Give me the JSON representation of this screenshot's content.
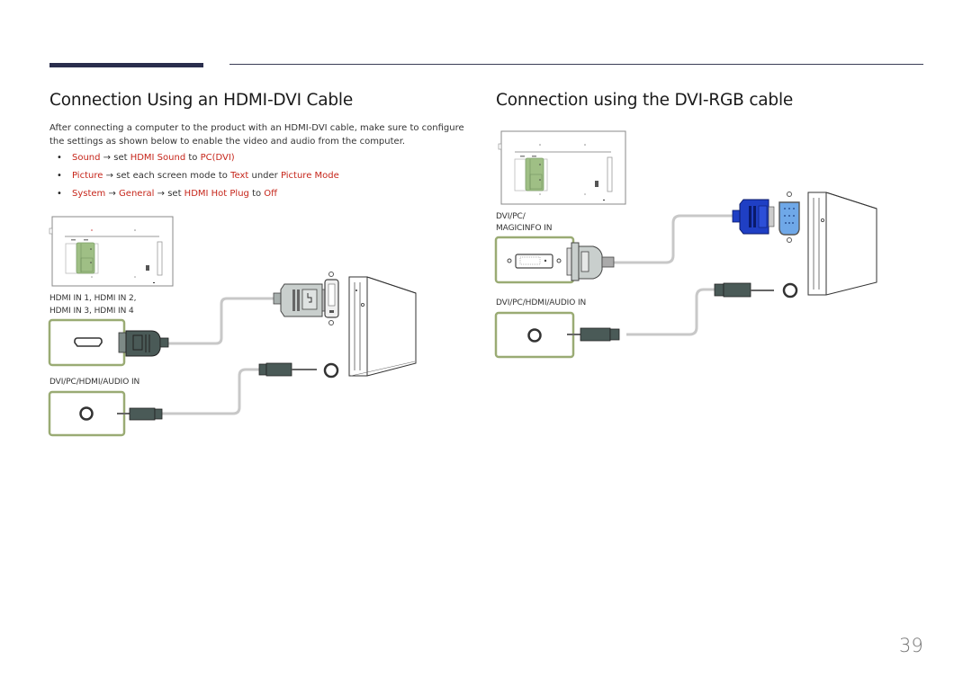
{
  "page": {
    "number": "39"
  },
  "left_section": {
    "title": "Connection Using an HDMI-DVI Cable",
    "intro": "After connecting a computer to the product with an HDMI-DVI cable, make sure to configure the settings as shown below to enable the video and audio from the computer.",
    "bullets": [
      {
        "parts": [
          {
            "text": "Sound",
            "highlight": true
          },
          {
            "text": " → set ",
            "highlight": false
          },
          {
            "text": "HDMI Sound",
            "highlight": true
          },
          {
            "text": " to ",
            "highlight": false
          },
          {
            "text": "PC(DVI)",
            "highlight": true
          }
        ]
      },
      {
        "parts": [
          {
            "text": "Picture",
            "highlight": true
          },
          {
            "text": " → set each screen mode to ",
            "highlight": false
          },
          {
            "text": "Text",
            "highlight": true
          },
          {
            "text": " under ",
            "highlight": false
          },
          {
            "text": "Picture Mode",
            "highlight": true
          }
        ]
      },
      {
        "parts": [
          {
            "text": "System",
            "highlight": true
          },
          {
            "text": " → ",
            "highlight": false
          },
          {
            "text": "General",
            "highlight": true
          },
          {
            "text": " → set ",
            "highlight": false
          },
          {
            "text": "HDMI Hot Plug",
            "highlight": true
          },
          {
            "text": " to ",
            "highlight": false
          },
          {
            "text": "Off",
            "highlight": true
          }
        ]
      }
    ],
    "port_label_hdmi_line1": "HDMI IN 1, HDMI IN 2,",
    "port_label_hdmi_line2": "HDMI IN 3, HDMI IN 4",
    "port_label_audio": "DVI/PC/HDMI/AUDIO IN"
  },
  "right_section": {
    "title": "Connection using the DVI-RGB cable",
    "port_label_dvi_line1": "DVI/PC/",
    "port_label_dvi_line2": "MAGICINFO IN",
    "port_label_audio": "DVI/PC/HDMI/AUDIO IN"
  },
  "colors": {
    "highlight": "#c6261b",
    "port_frame": "#9aab74",
    "vga_blue": "#1f3fc4",
    "connector_dark": "#4a5a57",
    "cable": "#c8c8c8"
  },
  "icons": {
    "monitor_back": "monitor-back-panel-icon",
    "hdmi_port": "hdmi-port-icon",
    "audio_jack": "audio-jack-icon",
    "dvi_port": "dvi-port-icon",
    "vga_port": "vga-port-icon",
    "pc_tower": "pc-tower-icon"
  }
}
